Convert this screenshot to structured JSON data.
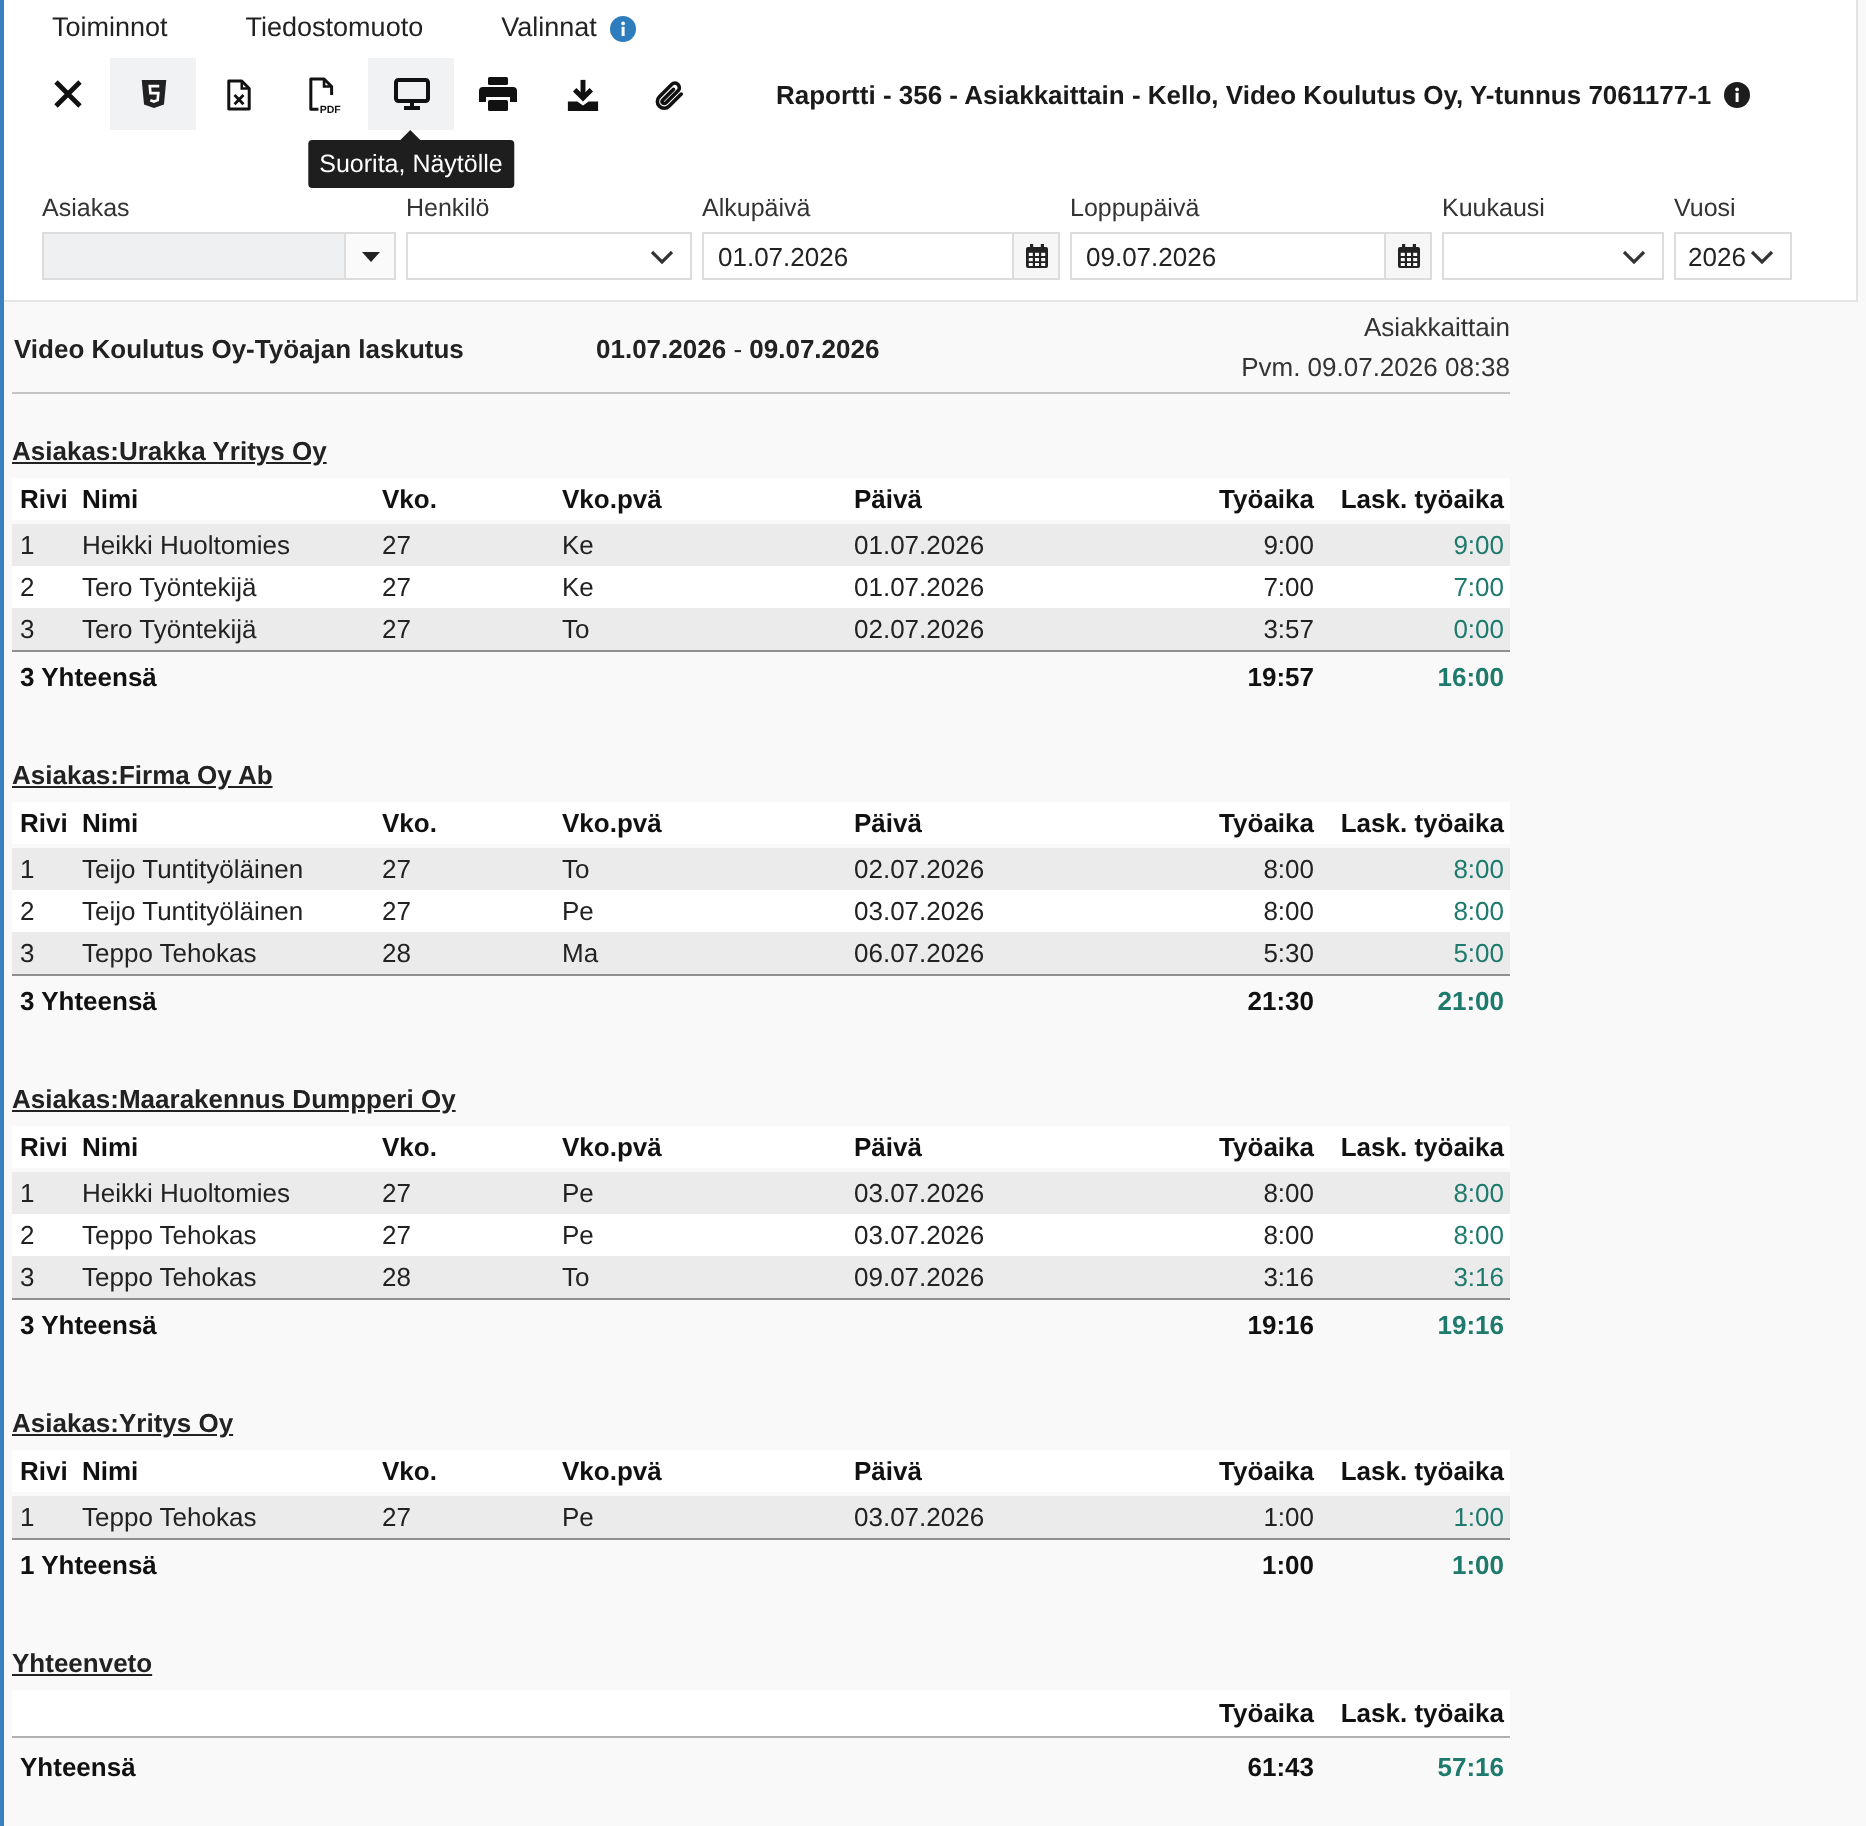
{
  "menu": [
    {
      "label": "Toiminnot",
      "info": false
    },
    {
      "label": "Tiedostomuoto",
      "info": false
    },
    {
      "label": "Valinnat",
      "info": true
    }
  ],
  "toolbar": [
    {
      "kind": "close",
      "selected": false,
      "hovered": false
    },
    {
      "kind": "html5",
      "selected": true,
      "hovered": false
    },
    {
      "kind": "excel",
      "selected": false,
      "hovered": false
    },
    {
      "kind": "pdf",
      "badge": "PDF",
      "selected": false,
      "hovered": false
    },
    {
      "kind": "monitor",
      "selected": true,
      "hovered": true
    },
    {
      "kind": "print",
      "selected": false,
      "hovered": false
    },
    {
      "kind": "download",
      "selected": false,
      "hovered": false
    },
    {
      "kind": "attach",
      "selected": false,
      "hovered": false
    }
  ],
  "tooltip": {
    "text": "Suorita, Näytölle"
  },
  "title": {
    "text": "Raportti - 356 - Asiakkaittain - Kello, Video Koulutus Oy, Y-tunnus 7061177-1",
    "info": true
  },
  "filters": [
    {
      "kind": "combo",
      "label": "Asiakas",
      "disabled": true
    },
    {
      "kind": "select",
      "label": "Henkilö",
      "disabled": false
    },
    {
      "kind": "date",
      "label": "Alkupäivä",
      "value": "01.07.2026",
      "disabled": false
    },
    {
      "kind": "date",
      "label": "Loppupäivä",
      "value": "09.07.2026",
      "disabled": false
    },
    {
      "kind": "select",
      "label": "Kuukausi",
      "disabled": false
    },
    {
      "kind": "select",
      "label": "Vuosi",
      "value": "2026",
      "disabled": false
    }
  ],
  "report": {
    "title": "Video Koulutus Oy-Työajan laskutus",
    "range": "**01.07.2026** - **09.07.2026**",
    "grouping": "Asiakkaittain",
    "printed": "Pvm. 09.07.2026 08:38",
    "groups": [
      {
        "title": "Asiakas:Urakka Yritys Oy",
        "columns": [
          "Rivi",
          "Nimi",
          "Vko.",
          "Vko.pvä",
          "Päivä",
          "Työaika",
          "Lask. työaika"
        ],
        "rows": [
          [
            "1",
            "Heikki Huoltomies",
            "27",
            "Ke",
            "01.07.2026",
            "9:00",
            "9:00"
          ],
          [
            "2",
            "Tero Työntekijä",
            "27",
            "Ke",
            "01.07.2026",
            "7:00",
            "7:00"
          ],
          [
            "3",
            "Tero Työntekijä",
            "27",
            "To",
            "02.07.2026",
            "3:57",
            "0:00"
          ]
        ],
        "total_label": "3 Yhteensä",
        "total_work": "19:57",
        "total_billed": "16:00"
      },
      {
        "title": "Asiakas:Firma Oy Ab",
        "columns": [
          "Rivi",
          "Nimi",
          "Vko.",
          "Vko.pvä",
          "Päivä",
          "Työaika",
          "Lask. työaika"
        ],
        "rows": [
          [
            "1",
            "Teijo Tuntityöläinen",
            "27",
            "To",
            "02.07.2026",
            "8:00",
            "8:00"
          ],
          [
            "2",
            "Teijo Tuntityöläinen",
            "27",
            "Pe",
            "03.07.2026",
            "8:00",
            "8:00"
          ],
          [
            "3",
            "Teppo Tehokas",
            "28",
            "Ma",
            "06.07.2026",
            "5:30",
            "5:00"
          ]
        ],
        "total_label": "3 Yhteensä",
        "total_work": "21:30",
        "total_billed": "21:00"
      },
      {
        "title": "Asiakas:Maarakennus Dumpperi Oy",
        "columns": [
          "Rivi",
          "Nimi",
          "Vko.",
          "Vko.pvä",
          "Päivä",
          "Työaika",
          "Lask. työaika"
        ],
        "rows": [
          [
            "1",
            "Heikki Huoltomies",
            "27",
            "Pe",
            "03.07.2026",
            "8:00",
            "8:00"
          ],
          [
            "2",
            "Teppo Tehokas",
            "27",
            "Pe",
            "03.07.2026",
            "8:00",
            "8:00"
          ],
          [
            "3",
            "Teppo Tehokas",
            "28",
            "To",
            "09.07.2026",
            "3:16",
            "3:16"
          ]
        ],
        "total_label": "3 Yhteensä",
        "total_work": "19:16",
        "total_billed": "19:16"
      },
      {
        "title": "Asiakas:Yritys Oy",
        "columns": [
          "Rivi",
          "Nimi",
          "Vko.",
          "Vko.pvä",
          "Päivä",
          "Työaika",
          "Lask. työaika"
        ],
        "rows": [
          [
            "1",
            "Teppo Tehokas",
            "27",
            "Pe",
            "03.07.2026",
            "1:00",
            "1:00"
          ]
        ],
        "total_label": "1 Yhteensä",
        "total_work": "1:00",
        "total_billed": "1:00"
      }
    ],
    "summary": {
      "title": "Yhteenveto",
      "columns": [
        "Työaika",
        "Lask. työaika"
      ],
      "total_label": "Yhteensä",
      "total_work": "61:43",
      "total_billed": "57:16"
    }
  }
}
